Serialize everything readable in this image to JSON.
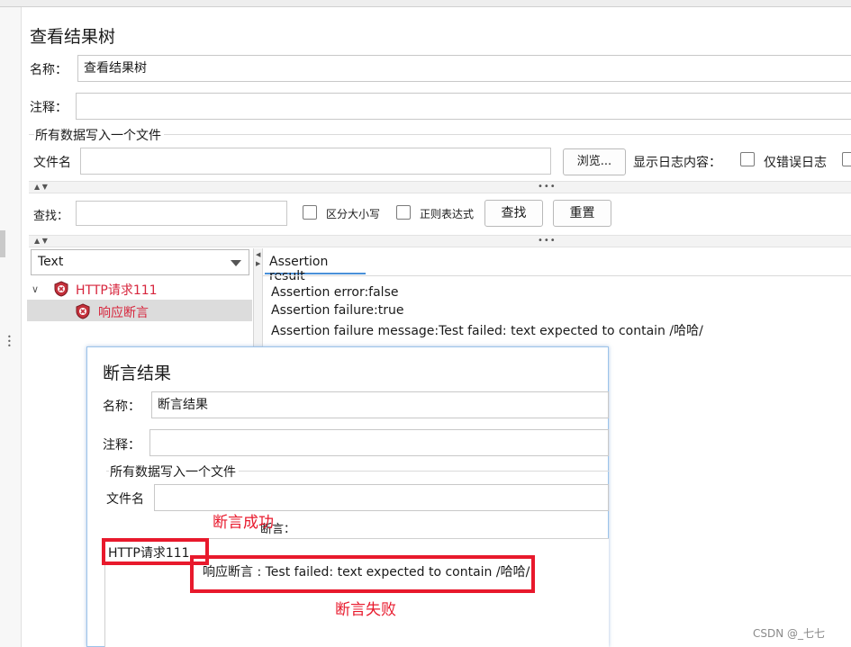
{
  "main": {
    "title": "查看结果树",
    "name_label": "名称：",
    "name_value": "查看结果树",
    "comment_label": "注释：",
    "file_section_title": "所有数据写入一个文件",
    "filename_label": "文件名",
    "browse_button": "浏览...",
    "log_content_label": "显示日志内容：",
    "errors_only_label": "仅错误日志",
    "search_label": "查找：",
    "case_sensitive_label": "区分大小写",
    "regex_label": "正则表达式",
    "find_button": "查找",
    "reset_button": "重置",
    "renderer_select": "Text",
    "tree": {
      "parent": "HTTP请求111",
      "child": "响应断言"
    },
    "result_tab": "Assertion result",
    "result_lines": [
      "Assertion error:false",
      "Assertion failure:true",
      "Assertion failure message:Test failed: text expected to contain /哈哈/"
    ]
  },
  "overlay": {
    "title": "断言结果",
    "name_label": "名称：",
    "name_value": "断言结果",
    "comment_label": "注释：",
    "file_section_title": "所有数据写入一个文件",
    "filename_label": "文件名",
    "assertion_label": "断言：",
    "result_item": "HTTP请求111",
    "result_detail": "响应断言 : Test failed: text expected to contain /哈哈/"
  },
  "annotations": {
    "success": "断言成功",
    "failure": "断言失败"
  },
  "watermark": "CSDN @_七七",
  "colors": {
    "annotation_red": "#e8192c",
    "tree_red": "#d7263d",
    "overlay_border": "#9cc3ea"
  }
}
